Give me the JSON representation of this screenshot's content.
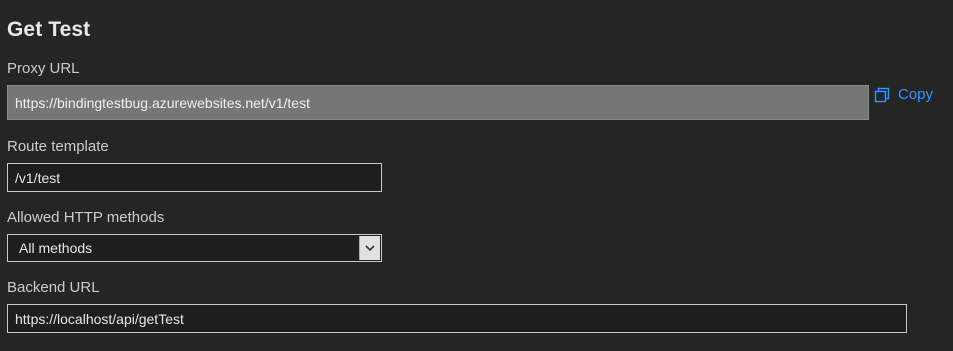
{
  "page": {
    "title": "Get Test"
  },
  "proxy_url": {
    "label": "Proxy URL",
    "value": "https://bindingtestbug.azurewebsites.net/v1/test",
    "copy_label": "Copy"
  },
  "route_template": {
    "label": "Route template",
    "value": "/v1/test"
  },
  "allowed_methods": {
    "label": "Allowed HTTP methods",
    "selected": "All methods"
  },
  "backend_url": {
    "label": "Backend URL",
    "value": "https://localhost/api/getTest"
  },
  "colors": {
    "background": "#252526",
    "link": "#3794ff",
    "readonly_field": "#767676"
  },
  "icons": {
    "copy": "copy-icon",
    "dropdown": "chevron-down-icon"
  }
}
